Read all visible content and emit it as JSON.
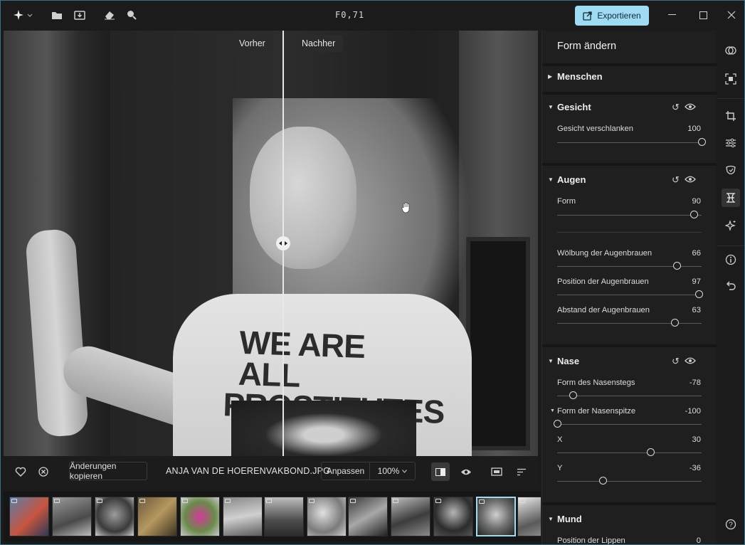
{
  "title_bar": {
    "title": "F0,71",
    "export_label": "Exportieren"
  },
  "canvas": {
    "before_label": "Vorher",
    "after_label": "Nachher",
    "shirt_line1": "WE ARE ALL",
    "shirt_line2": "PROSTITUTES"
  },
  "bottom_bar": {
    "copy_label": "Änderungen kopieren",
    "filename": "ANJA VAN DE HOERENVAKBOND.JPG",
    "fit_label": "Anpassen",
    "zoom": "100%"
  },
  "panel": {
    "title": "Form ändern",
    "sections": {
      "people": {
        "label": "Menschen"
      },
      "face": {
        "label": "Gesicht",
        "slim_label": "Gesicht verschlanken",
        "slim_value": "100"
      },
      "eyes": {
        "label": "Augen",
        "shape_label": "Form",
        "shape_value": "90",
        "arch_label": "Wölbung der Augenbrauen",
        "arch_value": "66",
        "pos_label": "Position der Augenbrauen",
        "pos_value": "97",
        "dist_label": "Abstand der Augenbrauen",
        "dist_value": "63"
      },
      "nose": {
        "label": "Nase",
        "bridge_label": "Form des Nasenstegs",
        "bridge_value": "-78",
        "tip_label": "Form der Nasenspitze",
        "tip_value": "-100",
        "x_label": "X",
        "x_value": "30",
        "y_label": "Y",
        "y_value": "-36"
      },
      "mouth": {
        "label": "Mund",
        "lips_label": "Position der Lippen",
        "lips_value": "0"
      }
    }
  },
  "slider_levels": {
    "slim": 100,
    "shape": 90,
    "arch": 66,
    "pos": 97,
    "dist": 63,
    "bridge": -78,
    "tip": -100,
    "x": 30,
    "y": -36
  },
  "colors": {
    "accent": "#9fdcf3",
    "panel_bg": "#1f1f1f",
    "window_border": "#3a6f86"
  }
}
